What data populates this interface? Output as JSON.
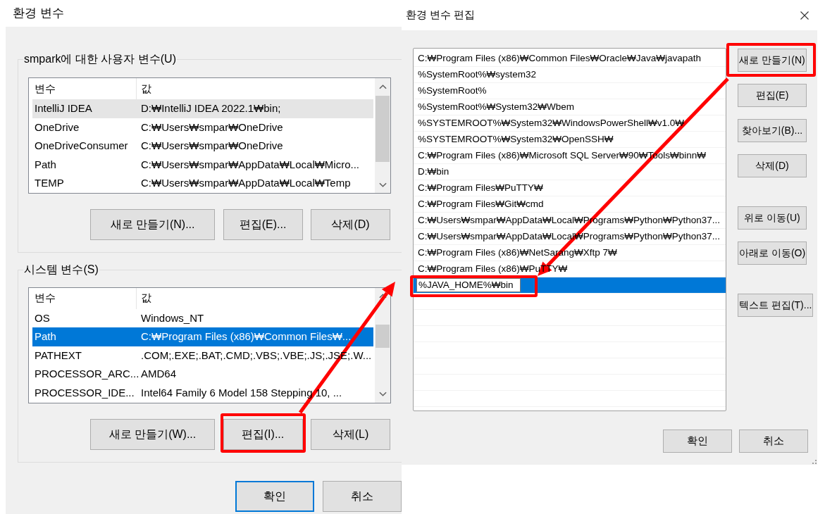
{
  "env_window": {
    "title": "환경 변수",
    "user_variables": {
      "label": "smpark에 대한 사용자 변수(U)",
      "focused": false,
      "columns": [
        "변수",
        "값"
      ],
      "rows": [
        {
          "name": "IntelliJ IDEA",
          "value": "D:₩IntelliJ IDEA 2022.1₩bin;",
          "selected": true
        },
        {
          "name": "OneDrive",
          "value": "C:₩Users₩smpar₩OneDrive",
          "selected": false
        },
        {
          "name": "OneDriveConsumer",
          "value": "C:₩Users₩smpar₩OneDrive",
          "selected": false
        },
        {
          "name": "Path",
          "value": "C:₩Users₩smpar₩AppData₩Local₩Micro...",
          "selected": false
        },
        {
          "name": "TEMP",
          "value": "C:₩Users₩smpar₩AppData₩Local₩Temp",
          "selected": false
        }
      ],
      "buttons": [
        {
          "label": "새로 만들기(N)...",
          "highlighted": false
        },
        {
          "label": "편집(E)...",
          "highlighted": false
        },
        {
          "label": "삭제(D)",
          "highlighted": false
        }
      ]
    },
    "system_variables": {
      "label": "시스템 변수(S)",
      "focused": true,
      "columns": [
        "변수",
        "값"
      ],
      "rows": [
        {
          "name": "OS",
          "value": "Windows_NT",
          "selected": false
        },
        {
          "name": "Path",
          "value": "C:₩Program Files (x86)₩Common Files₩...",
          "selected": true
        },
        {
          "name": "PATHEXT",
          "value": ".COM;.EXE;.BAT;.CMD;.VBS;.VBE;.JS;.JSE;.W...",
          "selected": false
        },
        {
          "name": "PROCESSOR_ARC...",
          "value": "AMD64",
          "selected": false
        },
        {
          "name": "PROCESSOR_IDE...",
          "value": "Intel64 Family 6 Model 158 Stepping 10, ...",
          "selected": false
        }
      ],
      "buttons": [
        {
          "label": "새로 만들기(W)...",
          "highlighted": false
        },
        {
          "label": "편집(I)...",
          "highlighted": true
        },
        {
          "label": "삭제(L)",
          "highlighted": false
        }
      ]
    },
    "buttons": [
      {
        "label": "확인",
        "default": true,
        "highlighted": false
      },
      {
        "label": "취소",
        "default": false,
        "highlighted": false
      }
    ]
  },
  "edit_window": {
    "title": "환경 변수 편집",
    "paths": [
      {
        "text": "C:₩Program Files (x86)₩Common Files₩Oracle₩Java₩javapath",
        "selected": false,
        "editing": false,
        "highlighted": false
      },
      {
        "text": "%SystemRoot%₩system32",
        "selected": false,
        "editing": false,
        "highlighted": false
      },
      {
        "text": "%SystemRoot%",
        "selected": false,
        "editing": false,
        "highlighted": false
      },
      {
        "text": "%SystemRoot%₩System32₩Wbem",
        "selected": false,
        "editing": false,
        "highlighted": false
      },
      {
        "text": "%SYSTEMROOT%₩System32₩WindowsPowerShell₩v1.0₩",
        "selected": false,
        "editing": false,
        "highlighted": false
      },
      {
        "text": "%SYSTEMROOT%₩System32₩OpenSSH₩",
        "selected": false,
        "editing": false,
        "highlighted": false
      },
      {
        "text": "C:₩Program Files (x86)₩Microsoft SQL Server₩90₩Tools₩binn₩",
        "selected": false,
        "editing": false,
        "highlighted": false
      },
      {
        "text": "D:₩bin",
        "selected": false,
        "editing": false,
        "highlighted": false
      },
      {
        "text": "C:₩Program Files₩PuTTY₩",
        "selected": false,
        "editing": false,
        "highlighted": false
      },
      {
        "text": "C:₩Program Files₩Git₩cmd",
        "selected": false,
        "editing": false,
        "highlighted": false
      },
      {
        "text": "C:₩Users₩smpar₩AppData₩Local₩Programs₩Python₩Python37...",
        "selected": false,
        "editing": false,
        "highlighted": false
      },
      {
        "text": "C:₩Users₩smpar₩AppData₩Local₩Programs₩Python₩Python37...",
        "selected": false,
        "editing": false,
        "highlighted": false
      },
      {
        "text": "C:₩Program Files (x86)₩NetSarang₩Xftp 7₩",
        "selected": false,
        "editing": false,
        "highlighted": false
      },
      {
        "text": "C:₩Program Files (x86)₩PuTTY₩",
        "selected": false,
        "editing": false,
        "highlighted": false
      },
      {
        "text": "%JAVA_HOME%₩bin",
        "selected": true,
        "editing": true,
        "highlighted": true
      }
    ],
    "side_button_groups": [
      [
        {
          "label": "새로 만들기(N)",
          "highlighted": true
        },
        {
          "label": "편집(E)",
          "highlighted": false
        },
        {
          "label": "찾아보기(B)...",
          "highlighted": false
        },
        {
          "label": "삭제(D)",
          "highlighted": false
        }
      ],
      [
        {
          "label": "위로 이동(U)",
          "highlighted": false
        },
        {
          "label": "아래로 이동(O)",
          "highlighted": false
        }
      ],
      [
        {
          "label": "텍스트 편집(T)...",
          "highlighted": false
        }
      ]
    ],
    "buttons": [
      {
        "label": "확인",
        "default": false,
        "highlighted": false
      },
      {
        "label": "취소",
        "default": false,
        "highlighted": false
      }
    ]
  }
}
